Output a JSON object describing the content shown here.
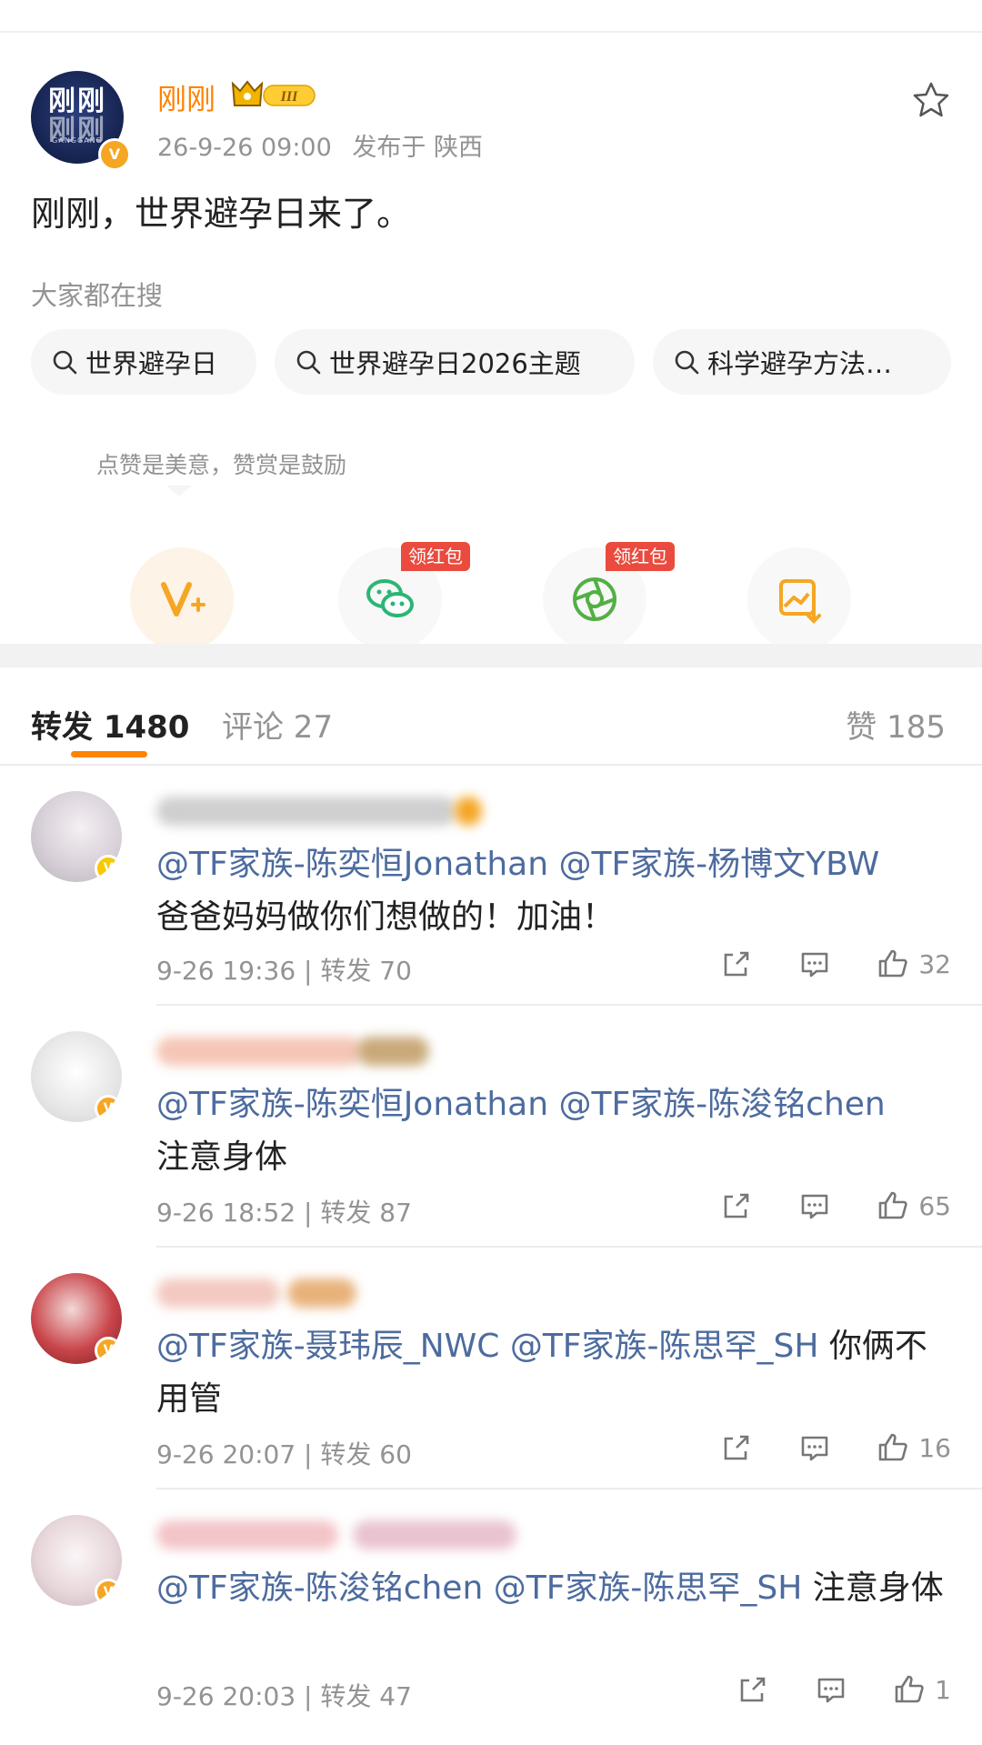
{
  "post": {
    "author": "刚刚",
    "avatar_text_top": "刚刚",
    "avatar_text_bottom": "刚刚",
    "avatar_sub": "GANGGANG",
    "level_badge": "III",
    "time": "26-9-26 09:00",
    "location": "发布于 陕西",
    "content": "刚刚，世界避孕日来了。"
  },
  "hot_search": {
    "title": "大家都在搜",
    "chips": [
      "世界避孕日",
      "世界避孕日2026主题",
      "科学避孕方法…"
    ]
  },
  "reward": {
    "tip": "点赞是美意，赞赏是鼓励",
    "red_packet_label": "领红包"
  },
  "tabs": {
    "repost": "转发 1480",
    "comment": "评论 27",
    "like": "赞 185"
  },
  "reposts": [
    {
      "mentions": [
        "@TF家族-陈奕恒Jonathan",
        "@TF家族-杨博文YBW"
      ],
      "message": "爸爸妈妈做你们想做的！加油！",
      "time": "9-26 19:36",
      "repost_count": "转发 70",
      "likes": "32"
    },
    {
      "mentions": [
        "@TF家族-陈奕恒Jonathan",
        "@TF家族-陈浚铭chen"
      ],
      "message": "注意身体",
      "time": "9-26 18:52",
      "repost_count": "转发 87",
      "likes": "65"
    },
    {
      "mentions": [
        "@TF家族-聂玮辰_NWC",
        "@TF家族-陈思罕_SH"
      ],
      "message": "你俩不用管",
      "time": "9-26 20:07",
      "repost_count": "转发 60",
      "likes": "16"
    },
    {
      "mentions": [
        "@TF家族-陈浚铭chen",
        "@TF家族-陈思罕_SH"
      ],
      "message": "注意身体",
      "time": "9-26 20:03",
      "repost_count": "转发 47",
      "likes": "1"
    }
  ],
  "colors": {
    "accent": "#ff8200",
    "mention": "#4d6b9e",
    "muted": "#939393",
    "verified": "#f5a623",
    "red_packet": "#ea4b3e"
  }
}
